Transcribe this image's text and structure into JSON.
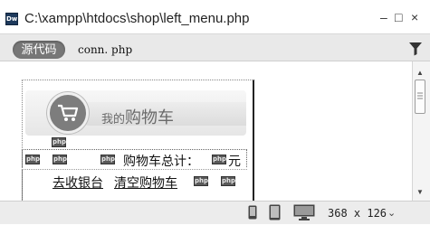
{
  "window": {
    "app_icon_text": "Dw",
    "title": "C:\\xampp\\htdocs\\shop\\left_menu.php",
    "minimize": "–",
    "maximize": "□",
    "close": "×"
  },
  "toolbar": {
    "source_code_label": "源代码",
    "related_file": "conn. php",
    "filter_icon": "filter-icon"
  },
  "design": {
    "cart_title_small": "我的",
    "cart_title_big": "购物车",
    "php_marker": "php",
    "total_label": "购物车总计：",
    "currency": "元",
    "checkout_link": "去收银台",
    "clear_cart_link": "清空购物车"
  },
  "statusbar": {
    "window_size": "368 x 126",
    "dropdown_caret": "⌄",
    "icons": [
      "phone-icon",
      "tablet-icon",
      "desktop-icon"
    ]
  },
  "colors": {
    "source_button": "#777777",
    "php_icon": "#5a5a5a"
  }
}
